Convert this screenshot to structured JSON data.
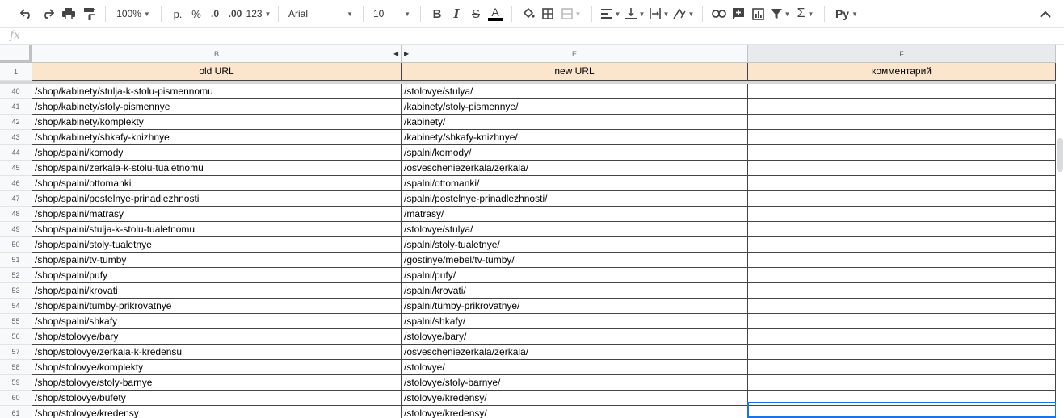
{
  "toolbar": {
    "zoom": "100%",
    "currency": "р.",
    "percent": "%",
    "decimal_decrease": ".0",
    "decimal_increase": ".00",
    "number_format": "123",
    "font": "Arial",
    "font_size": "10",
    "input_tools": "Ру",
    "text_color": "#000000"
  },
  "formula_bar": {
    "fx": "fx",
    "value": ""
  },
  "columns": [
    {
      "letter": "B"
    },
    {
      "letter": "E"
    },
    {
      "letter": "F"
    }
  ],
  "header_row": {
    "number": "1",
    "cells": [
      "old URL",
      "new URL",
      "комментарий"
    ]
  },
  "rows": [
    {
      "num": "40",
      "old": "/shop/kabinety/stulja-k-stolu-pismennomu",
      "new": "/stolovye/stulya/",
      "comment": ""
    },
    {
      "num": "41",
      "old": "/shop/kabinety/stoly-pismennye",
      "new": "/kabinety/stoly-pismennye/",
      "comment": ""
    },
    {
      "num": "42",
      "old": "/shop/kabinety/komplekty",
      "new": "/kabinety/",
      "comment": ""
    },
    {
      "num": "43",
      "old": "/shop/kabinety/shkafy-knizhnye",
      "new": "/kabinety/shkafy-knizhnye/",
      "comment": ""
    },
    {
      "num": "44",
      "old": "/shop/spalni/komody",
      "new": "/spalni/komody/",
      "comment": ""
    },
    {
      "num": "45",
      "old": "/shop/spalni/zerkala-k-stolu-tualetnomu",
      "new": "/osvescheniezerkala/zerkala/",
      "comment": ""
    },
    {
      "num": "46",
      "old": "/shop/spalni/ottomanki",
      "new": "/spalni/ottomanki/",
      "comment": ""
    },
    {
      "num": "47",
      "old": "/shop/spalni/postelnye-prinadlezhnosti",
      "new": "/spalni/postelnye-prinadlezhnosti/",
      "comment": ""
    },
    {
      "num": "48",
      "old": "/shop/spalni/matrasy",
      "new": "/matrasy/",
      "comment": ""
    },
    {
      "num": "49",
      "old": "/shop/spalni/stulja-k-stolu-tualetnomu",
      "new": "/stolovye/stulya/",
      "comment": ""
    },
    {
      "num": "50",
      "old": "/shop/spalni/stoly-tualetnye",
      "new": "/spalni/stoly-tualetnye/",
      "comment": ""
    },
    {
      "num": "51",
      "old": "/shop/spalni/tv-tumby",
      "new": "/gostinye/mebel/tv-tumby/",
      "comment": ""
    },
    {
      "num": "52",
      "old": "/shop/spalni/pufy",
      "new": "/spalni/pufy/",
      "comment": ""
    },
    {
      "num": "53",
      "old": "/shop/spalni/krovati",
      "new": "/spalni/krovati/",
      "comment": ""
    },
    {
      "num": "54",
      "old": "/shop/spalni/tumby-prikrovatnye",
      "new": "/spalni/tumby-prikrovatnye/",
      "comment": ""
    },
    {
      "num": "55",
      "old": "/shop/spalni/shkafy",
      "new": "/spalni/shkafy/",
      "comment": ""
    },
    {
      "num": "56",
      "old": "/shop/stolovye/bary",
      "new": "/stolovye/bary/",
      "comment": ""
    },
    {
      "num": "57",
      "old": "/shop/stolovye/zerkala-k-kredensu",
      "new": "/osvescheniezerkala/zerkala/",
      "comment": ""
    },
    {
      "num": "58",
      "old": "/shop/stolovye/komplekty",
      "new": "/stolovye/",
      "comment": ""
    },
    {
      "num": "59",
      "old": "/shop/stolovye/stoly-barnye",
      "new": "/stolovye/stoly-barnye/",
      "comment": ""
    },
    {
      "num": "60",
      "old": "/shop/stolovye/bufety",
      "new": "/stolovye/kredensy/",
      "comment": ""
    },
    {
      "num": "61",
      "old": "/shop/stolovye/kredensy",
      "new": "/stolovye/kredensy/",
      "comment": ""
    }
  ],
  "colors": {
    "header_fill": "#fce5cd",
    "selection": "#1a73e8",
    "grid_line": "#444444"
  }
}
